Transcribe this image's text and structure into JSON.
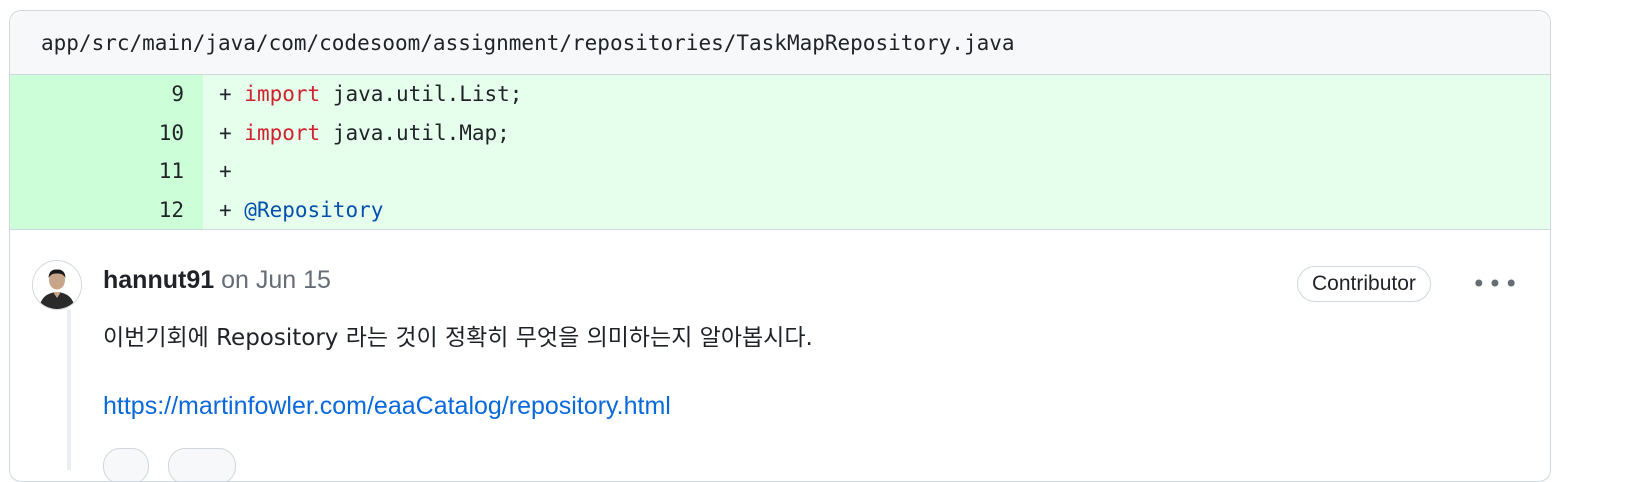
{
  "file": {
    "path": "app/src/main/java/com/codesoom/assignment/repositories/TaskMapRepository.java"
  },
  "diff": {
    "lines": [
      {
        "num": "9",
        "sign": "+ ",
        "keyword": "import",
        "rest": " java.util.List;"
      },
      {
        "num": "10",
        "sign": "+ ",
        "keyword": "import",
        "rest": " java.util.Map;"
      },
      {
        "num": "11",
        "sign": "+",
        "keyword": "",
        "rest": ""
      },
      {
        "num": "12",
        "sign": "+ ",
        "annotation": "@Repository"
      }
    ]
  },
  "comment": {
    "author": "hannut91",
    "date": "on Jun 15",
    "badge": "Contributor",
    "more": "•••",
    "body": "이번기회에 Repository 라는 것이 정확히 무엇을 의미하는지 알아봅시다.",
    "link": "https://martinfowler.com/eaaCatalog/repository.html"
  },
  "colors": {
    "addition_bg": "#e6ffec",
    "addition_num_bg": "#ccffd8",
    "keyword": "#cf222e",
    "annotation": "#0550ae",
    "link": "#0969da"
  }
}
